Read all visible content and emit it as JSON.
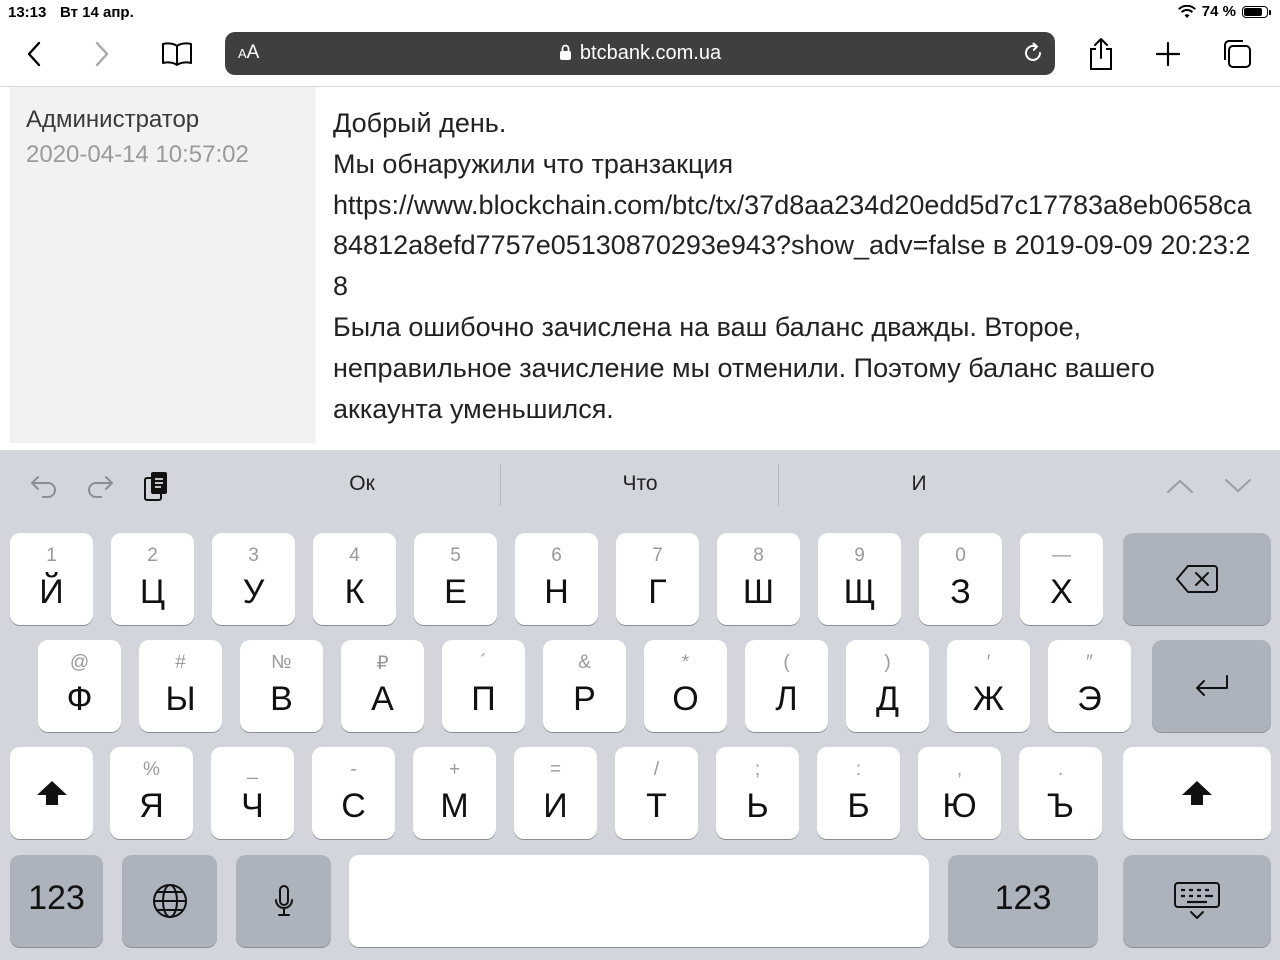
{
  "status": {
    "time": "13:13",
    "date": "Вт 14 апр.",
    "battery_percent": "74 %",
    "battery_level": 0.74
  },
  "browser": {
    "text_size_small": "A",
    "text_size_large": "A",
    "url": "btcbank.com.ua"
  },
  "message": {
    "author": "Администратор",
    "timestamp": "2020-04-14 10:57:02",
    "greeting": "Добрый день.",
    "line1": "Мы обнаружили что транзакция",
    "link": "https://www.blockchain.com/btc/tx/37d8aa234d20edd5d7c17783a8eb0658ca84812a8efd7757e05130870293e943?show_adv=false",
    "link_suffix": " в 2019-09-09 20:23:28",
    "line2": "Была ошибочно зачислена на ваш баланс дважды. Второе, неправильное зачисление мы отменили. Поэтому баланс вашего аккаунта уменьшился."
  },
  "keyboard": {
    "suggestions": [
      "Ок",
      "Что",
      "И"
    ],
    "row1": [
      {
        "main": "Й",
        "alt": "1"
      },
      {
        "main": "Ц",
        "alt": "2"
      },
      {
        "main": "У",
        "alt": "3"
      },
      {
        "main": "К",
        "alt": "4"
      },
      {
        "main": "Е",
        "alt": "5"
      },
      {
        "main": "Н",
        "alt": "6"
      },
      {
        "main": "Г",
        "alt": "7"
      },
      {
        "main": "Ш",
        "alt": "8"
      },
      {
        "main": "Щ",
        "alt": "9"
      },
      {
        "main": "З",
        "alt": "0"
      },
      {
        "main": "Х",
        "alt": "—"
      }
    ],
    "row2": [
      {
        "main": "Ф",
        "alt": "@"
      },
      {
        "main": "Ы",
        "alt": "#"
      },
      {
        "main": "В",
        "alt": "№"
      },
      {
        "main": "А",
        "alt": "₽"
      },
      {
        "main": "П",
        "alt": "´"
      },
      {
        "main": "Р",
        "alt": "&"
      },
      {
        "main": "О",
        "alt": "*"
      },
      {
        "main": "Л",
        "alt": "("
      },
      {
        "main": "Д",
        "alt": ")"
      },
      {
        "main": "Ж",
        "alt": "′"
      },
      {
        "main": "Э",
        "alt": "″"
      }
    ],
    "row3": [
      {
        "main": "Я",
        "alt": "%"
      },
      {
        "main": "Ч",
        "alt": "_"
      },
      {
        "main": "С",
        "alt": "-"
      },
      {
        "main": "М",
        "alt": "+"
      },
      {
        "main": "И",
        "alt": "="
      },
      {
        "main": "Т",
        "alt": "/"
      },
      {
        "main": "Ь",
        "alt": ";"
      },
      {
        "main": "Б",
        "alt": ":"
      },
      {
        "main": "Ю",
        "alt": ","
      },
      {
        "main": "Ъ",
        "alt": "."
      }
    ],
    "numbers_label": "123"
  },
  "colors": {
    "address_bar": "#3f3f41",
    "keyboard_bg": "#d2d5dc",
    "key": "#ffffff",
    "key_dark": "#adb3bd"
  }
}
